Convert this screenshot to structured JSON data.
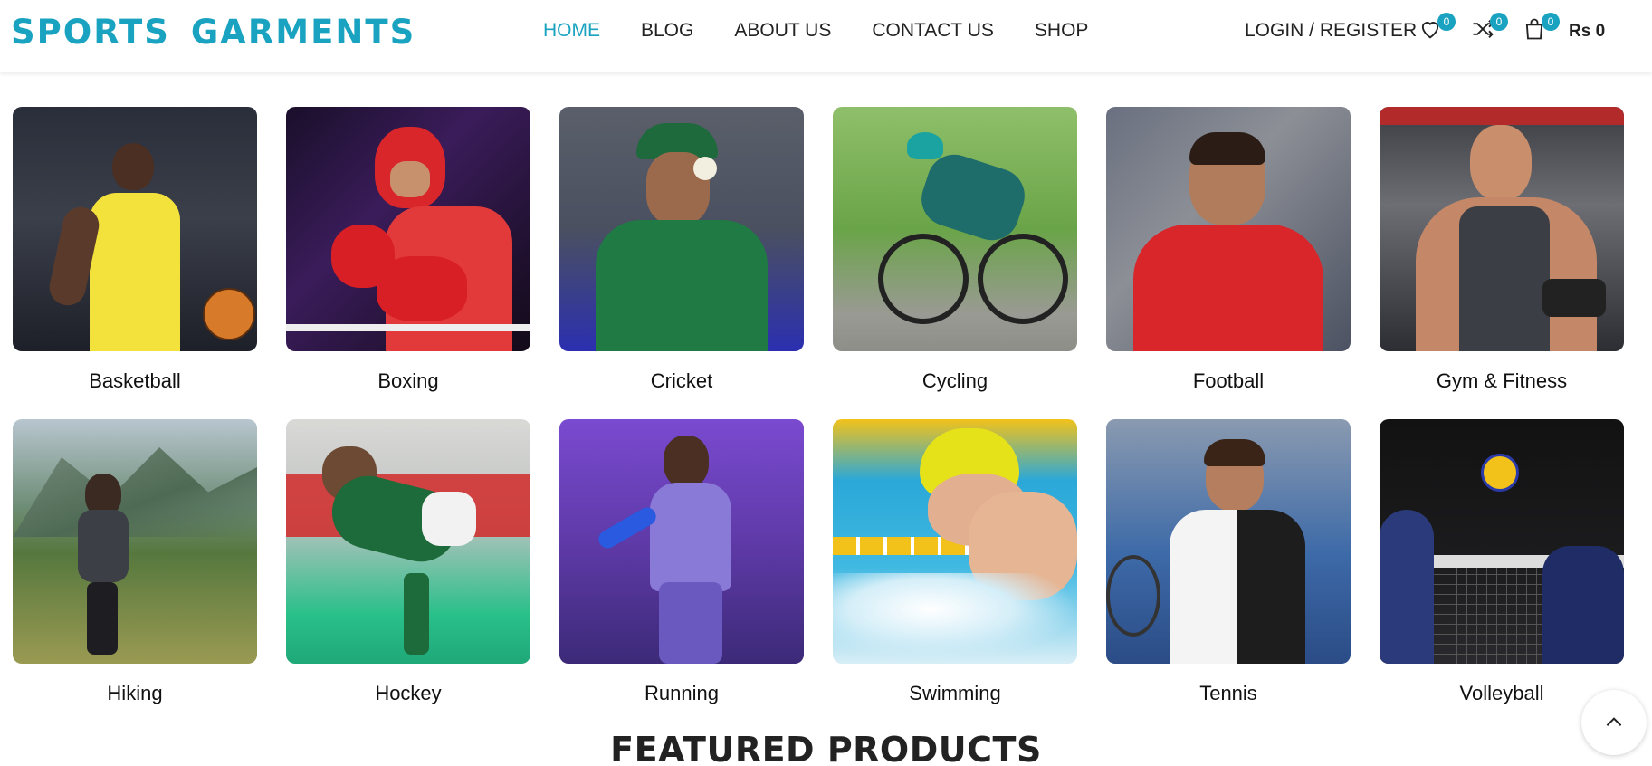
{
  "header": {
    "logo": "SPORTS GARMENTS",
    "nav": [
      {
        "label": "HOME",
        "active": true
      },
      {
        "label": "BLOG"
      },
      {
        "label": "ABOUT US"
      },
      {
        "label": "CONTACT US"
      },
      {
        "label": "SHOP"
      }
    ],
    "login_label": "LOGIN / REGISTER",
    "wishlist_count": "0",
    "compare_count": "0",
    "cart_count": "0",
    "cart_total": "Rs 0"
  },
  "categories": [
    {
      "label": "Basketball"
    },
    {
      "label": "Boxing"
    },
    {
      "label": "Cricket"
    },
    {
      "label": "Cycling"
    },
    {
      "label": "Football"
    },
    {
      "label": "Gym & Fitness"
    },
    {
      "label": "Hiking"
    },
    {
      "label": "Hockey"
    },
    {
      "label": "Running"
    },
    {
      "label": "Swimming"
    },
    {
      "label": "Tennis"
    },
    {
      "label": "Volleyball"
    }
  ],
  "featured_heading": "FEATURED PRODUCTS",
  "colors": {
    "accent": "#1aa3c0",
    "text": "#222222"
  },
  "icons": {
    "wishlist": "heart-icon",
    "compare": "shuffle-icon",
    "cart": "shopping-bag-icon",
    "scroll_top": "chevron-up-icon"
  }
}
